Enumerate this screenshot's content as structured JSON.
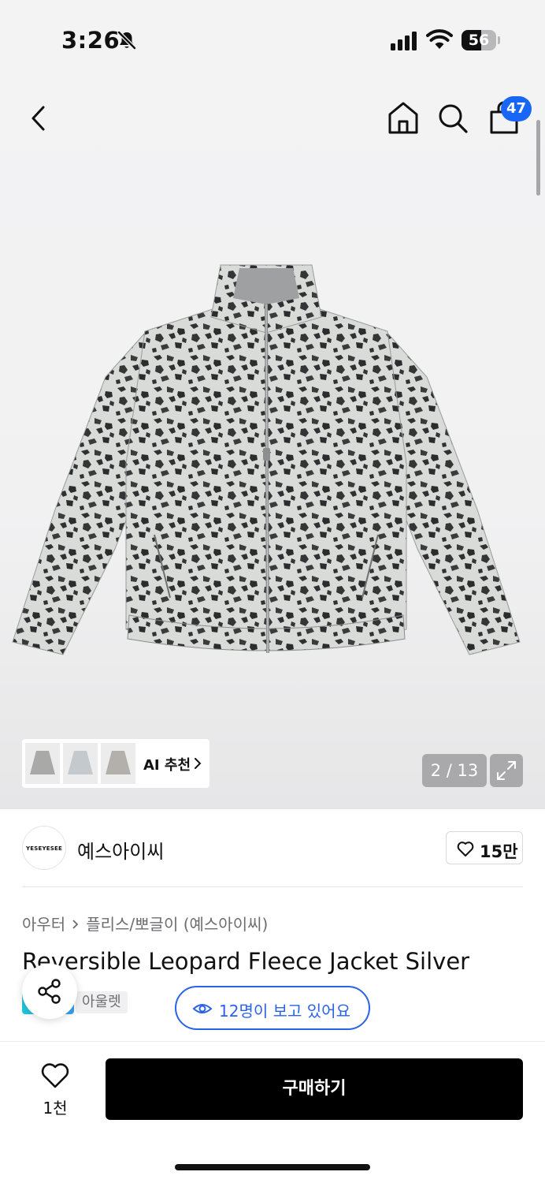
{
  "status_bar": {
    "time": "3:26",
    "battery_level": "56"
  },
  "header": {
    "cart_count": "47"
  },
  "gallery": {
    "ai_recommend_label": "AI 추천",
    "page_counter": "2 / 13"
  },
  "brand": {
    "logo_text": "YESEYESEE",
    "name": "예스아이씨",
    "likes": "15만"
  },
  "product": {
    "breadcrumb": [
      "아우터",
      "플리스/뽀글이 (예스아이씨)"
    ],
    "title": "Reversible Leopard Fleece Jacket Silver",
    "outlet_tag": "아울렛",
    "viewers": "12명이 보고 있어요"
  },
  "bottom_bar": {
    "wish_count": "1천",
    "buy_label": "구매하기"
  },
  "colors": {
    "accent_blue": "#2a62e8",
    "badge_blue": "#1766f5",
    "buy_button": "#000000"
  },
  "icons": [
    "bell-slash-icon",
    "signal-icon",
    "wifi-icon",
    "back-icon",
    "home-icon",
    "search-icon",
    "bag-icon",
    "chevron-right-icon",
    "expand-icon",
    "heart-icon",
    "eye-icon",
    "share-icon"
  ]
}
